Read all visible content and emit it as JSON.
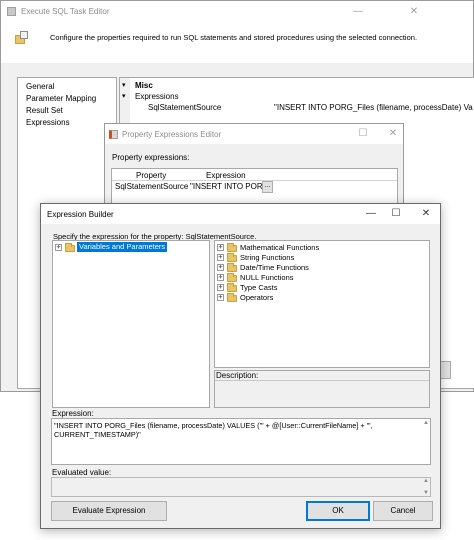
{
  "sql_task_editor": {
    "title": "Execute SQL Task Editor",
    "minimize": "—",
    "close": "✕",
    "description": "Configure the properties required to run SQL statements and stored procedures using the selected connection.",
    "nav_items": [
      "General",
      "Parameter Mapping",
      "Result Set",
      "Expressions"
    ],
    "misc_header": "Misc",
    "expressions_label": "Expressions",
    "property_name": "SqlStatementSource",
    "property_value": "\"INSERT INTO PORG_Files (filename, processDate) Va"
  },
  "property_expressions_editor": {
    "title": "Property Expressions Editor",
    "maximize": "☐",
    "close": "✕",
    "label": "Property expressions:",
    "col_property": "Property",
    "col_expression": "Expression",
    "row_property": "SqlStatementSource",
    "row_expression": "\"INSERT INTO POR...",
    "ellipsis": "..."
  },
  "expression_builder": {
    "title": "Expression Builder",
    "minimize": "—",
    "maximize": "☐",
    "close": "✕",
    "instruction": "Specify the expression for the property: SqlStatementSource.",
    "variables_node": "Variables and Parameters",
    "functions": [
      "Mathematical Functions",
      "String Functions",
      "Date/Time Functions",
      "NULL Functions",
      "Type Casts",
      "Operators"
    ],
    "description_label": "Description:",
    "expression_label": "Expression:",
    "expression_line1": "\"INSERT INTO PORG_Files (filename, processDate) VALUES ('\" + @[User::CurrentFileName] + \"',",
    "expression_line2": "CURRENT_TIMESTAMP)\"",
    "evaluated_label": "Evaluated value:",
    "evaluate_button": "Evaluate Expression",
    "ok_button": "OK",
    "cancel_button": "Cancel"
  }
}
